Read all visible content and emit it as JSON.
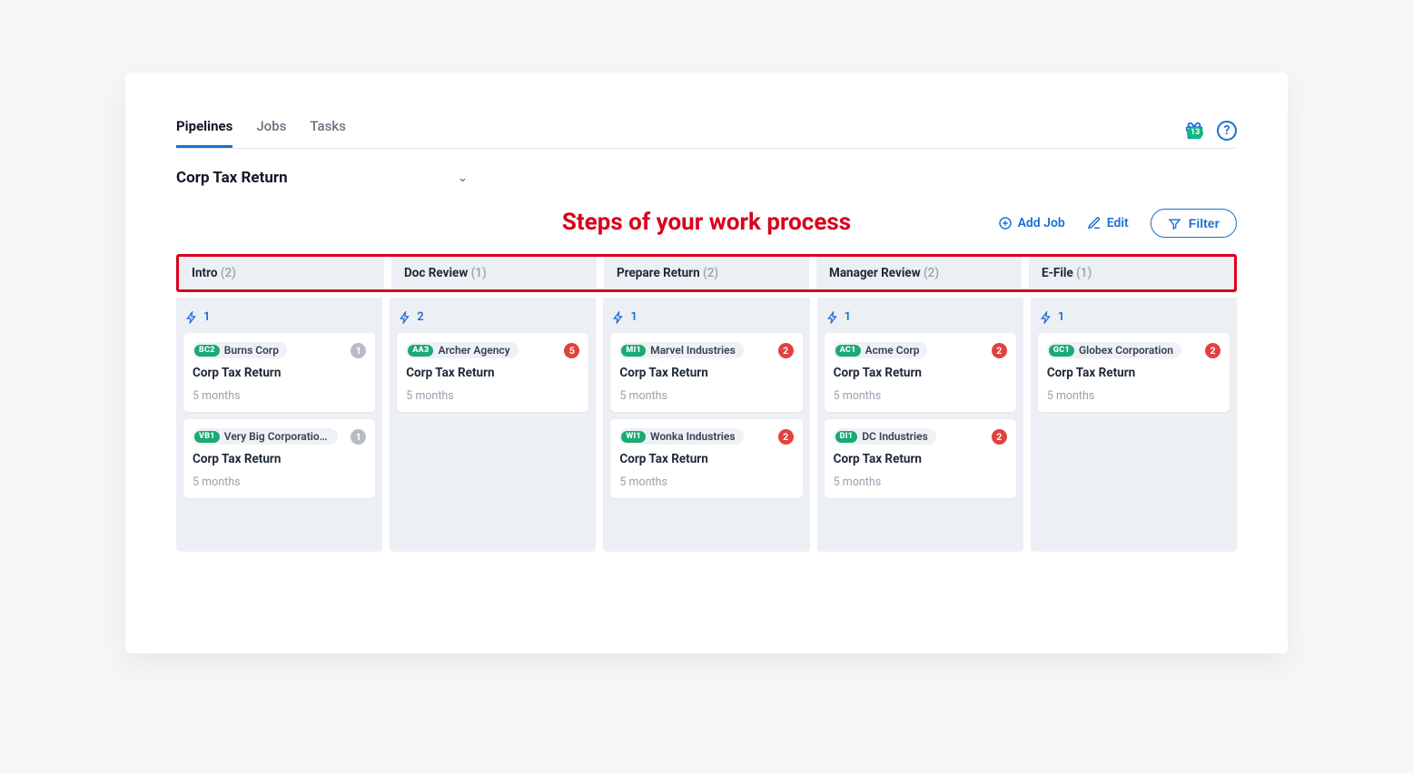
{
  "tabs": [
    {
      "label": "Pipelines",
      "active": true
    },
    {
      "label": "Jobs",
      "active": false
    },
    {
      "label": "Tasks",
      "active": false
    }
  ],
  "gift_badge": "13",
  "pipeline_name": "Corp Tax Return",
  "annotation": "Steps of your work process",
  "actions": {
    "add_job": "Add Job",
    "edit": "Edit",
    "filter": "Filter"
  },
  "columns": [
    {
      "name": "Intro",
      "count": 2,
      "stat": 1,
      "cards": [
        {
          "tag_code": "BC2",
          "tag_color": "#1aaa72",
          "client": "Burns Corp",
          "badge": 1,
          "badge_color": "gray",
          "title": "Corp Tax Return",
          "meta": "5 months"
        },
        {
          "tag_code": "VB1",
          "tag_color": "#1aaa72",
          "client": "Very Big Corporation of Am…",
          "badge": 1,
          "badge_color": "gray",
          "title": "Corp Tax Return",
          "meta": "5 months"
        }
      ]
    },
    {
      "name": "Doc Review",
      "count": 1,
      "stat": 2,
      "cards": [
        {
          "tag_code": "AA3",
          "tag_color": "#1aaa72",
          "client": "Archer Agency",
          "badge": 5,
          "badge_color": "red",
          "title": "Corp Tax Return",
          "meta": "5 months"
        }
      ]
    },
    {
      "name": "Prepare Return",
      "count": 2,
      "stat": 1,
      "cards": [
        {
          "tag_code": "MI1",
          "tag_color": "#1aaa72",
          "client": "Marvel Industries",
          "badge": 2,
          "badge_color": "red",
          "title": "Corp Tax Return",
          "meta": "5 months"
        },
        {
          "tag_code": "WI1",
          "tag_color": "#1aaa72",
          "client": "Wonka Industries",
          "badge": 2,
          "badge_color": "red",
          "title": "Corp Tax Return",
          "meta": "5 months"
        }
      ]
    },
    {
      "name": "Manager Review",
      "count": 2,
      "stat": 1,
      "cards": [
        {
          "tag_code": "AC1",
          "tag_color": "#1aaa72",
          "client": "Acme Corp",
          "badge": 2,
          "badge_color": "red",
          "title": "Corp Tax Return",
          "meta": "5 months"
        },
        {
          "tag_code": "DI1",
          "tag_color": "#1aaa72",
          "client": "DC Industries",
          "badge": 2,
          "badge_color": "red",
          "title": "Corp Tax Return",
          "meta": "5 months"
        }
      ]
    },
    {
      "name": "E-File",
      "count": 1,
      "stat": 1,
      "cards": [
        {
          "tag_code": "GC1",
          "tag_color": "#1aaa72",
          "client": "Globex Corporation",
          "badge": 2,
          "badge_color": "red",
          "title": "Corp Tax Return",
          "meta": "5 months"
        }
      ]
    }
  ]
}
